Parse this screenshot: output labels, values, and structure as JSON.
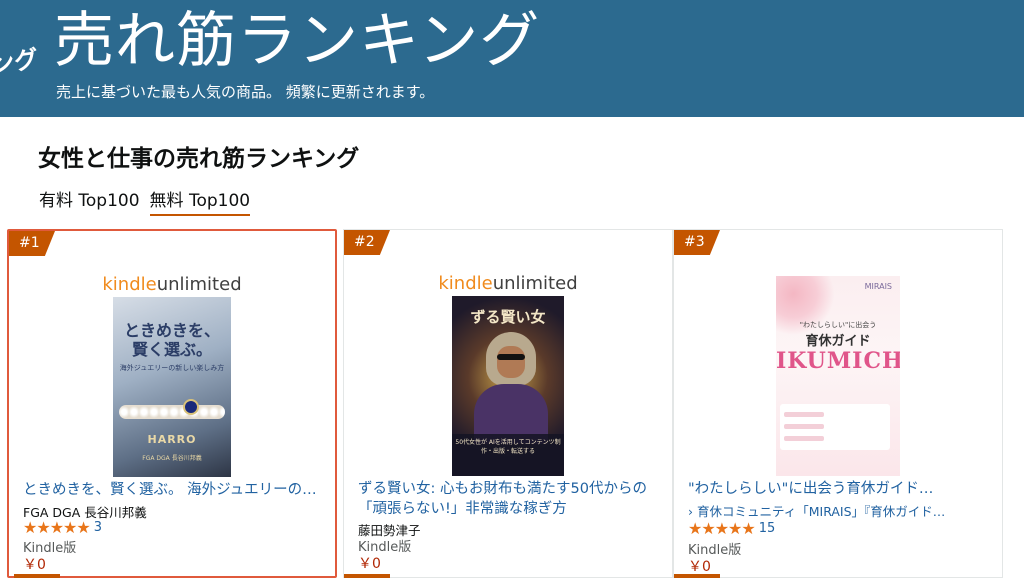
{
  "banner": {
    "edge_text": "ング",
    "title": "売れ筋ランキング",
    "subtitle": "売上に基づいた最も人気の商品。 頻繁に更新されます。"
  },
  "heading": "女性と仕事の売れ筋ランキング",
  "tabs": [
    {
      "label": "有料 Top100",
      "active": false
    },
    {
      "label": "無料 Top100",
      "active": true
    }
  ],
  "kindle_unlimited": {
    "k": "kindle",
    "u": "unlimited"
  },
  "products": [
    {
      "rank": "#1",
      "cover": {
        "line1": "ときめきを、",
        "line2": "賢く選ぶ。",
        "line3": "海外ジュエリーの新しい楽しみ方",
        "brand": "HARRO",
        "author": "FGA DGA 長谷川邦義"
      },
      "title": "ときめきを、賢く選ぶ。 海外ジュエリーの新…",
      "author": "FGA DGA 長谷川邦義",
      "stars": "★★★★★",
      "rating_value": 5,
      "rating_count": "3",
      "format": "Kindle版",
      "price": "￥0"
    },
    {
      "rank": "#2",
      "cover": {
        "line1": "ずる賢い女",
        "band_text": "50代女性が AIを活用してコンテンツ制作・出版・転送する",
        "author": "藤田勢津子"
      },
      "title": "ずる賢い女: 心もお財布も満たす50代からの「頑張らない!」非常識な稼ぎ方",
      "author": "藤田勢津子",
      "format": "Kindle版",
      "price": "￥0"
    },
    {
      "rank": "#3",
      "cover": {
        "brand": "MIRAIS",
        "line0": "\"わたしらしい\"に出会う",
        "line1": "育休ガイド",
        "line2": "IKUMICHI"
      },
      "title": "\"わたしらしい\"に出会う育休ガイド…",
      "author": "› 育休コミュニティ「MIRAIS」『育休ガイド…",
      "stars": "★★★★★",
      "rating_value": 5,
      "rating_count": "15",
      "format": "Kindle版",
      "price": "￥0"
    }
  ]
}
